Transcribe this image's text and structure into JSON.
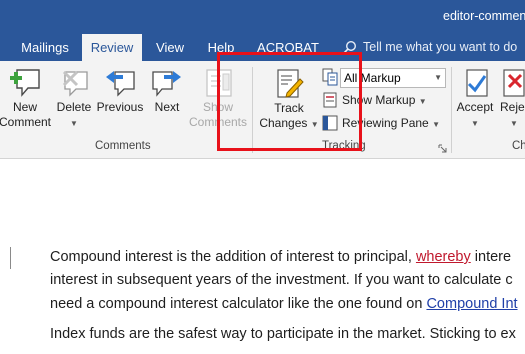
{
  "window": {
    "title": "editor-commen"
  },
  "tabs": [
    {
      "label": "Mailings",
      "active": false
    },
    {
      "label": "Review",
      "active": true
    },
    {
      "label": "View",
      "active": false
    },
    {
      "label": "Help",
      "active": false
    },
    {
      "label": "ACROBAT",
      "active": false
    }
  ],
  "tell_me": {
    "placeholder": "Tell me what you want to do"
  },
  "ribbon": {
    "comments": {
      "new_line1": "New",
      "new_line2": "Comment",
      "delete": "Delete",
      "previous": "Previous",
      "next": "Next",
      "show_line1": "Show",
      "show_line2": "Comments",
      "group_label": "Comments"
    },
    "tracking": {
      "track_line1": "Track",
      "track_line2": "Changes",
      "markup_combo": "All Markup",
      "show_markup": "Show Markup",
      "reviewing_pane": "Reviewing Pane",
      "group_label": "Tracking"
    },
    "changes": {
      "accept": "Accept",
      "reject": "Reje",
      "group_label": "Ch"
    }
  },
  "document": {
    "p1_line1_a": "Compound interest is the addition of interest to principal, ",
    "p1_line1_revised": "whereby",
    "p1_line1_b": " intere",
    "p1_line2": "interest in subsequent years of the investment. If you want to calculate c",
    "p1_line3_a": "need a compound interest calculator like the one found on ",
    "p1_line3_link": "Compound Int",
    "p2_line1": "Index funds are the safest way to participate in the market. Sticking to ex"
  },
  "colors": {
    "brand": "#2b579a",
    "highlight_box": "#e8111a",
    "link": "#1f3fa8",
    "revision": "#c0182d"
  }
}
